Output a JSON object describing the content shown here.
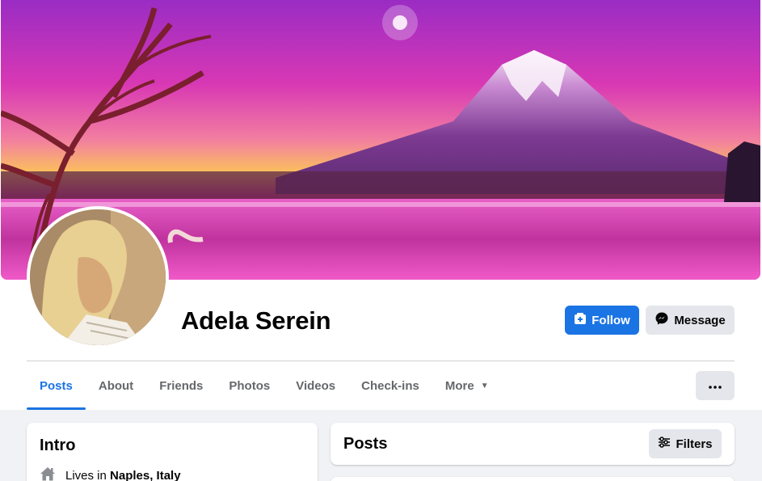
{
  "profile": {
    "name": "Adela Serein"
  },
  "actions": {
    "follow_label": "Follow",
    "message_label": "Message",
    "more_icon": "ellipsis-icon"
  },
  "tabs": [
    {
      "label": "Posts",
      "active": true
    },
    {
      "label": "About"
    },
    {
      "label": "Friends"
    },
    {
      "label": "Photos"
    },
    {
      "label": "Videos"
    },
    {
      "label": "Check-ins"
    },
    {
      "label": "More"
    }
  ],
  "intro": {
    "title": "Intro",
    "lives_prefix": "Lives in",
    "lives_place": "Naples, Italy"
  },
  "posts": {
    "title": "Posts",
    "filters_label": "Filters"
  },
  "colors": {
    "accent": "#1b74e4",
    "secondary_button": "#e4e6eb",
    "page_background": "#f0f2f5"
  }
}
